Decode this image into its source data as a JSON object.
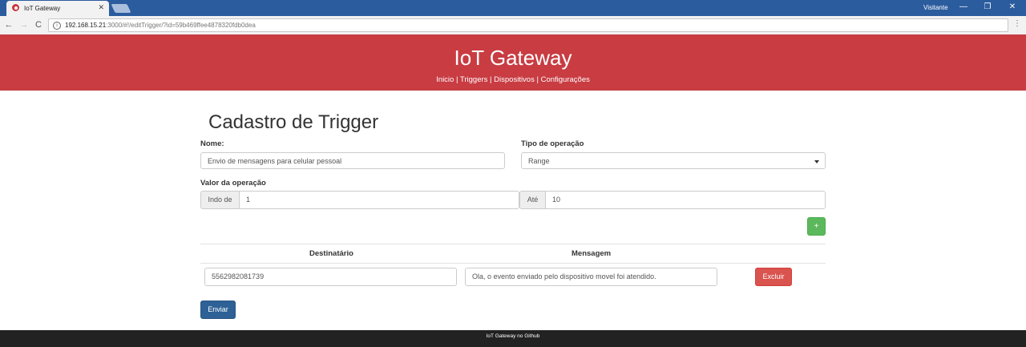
{
  "browser": {
    "tab_title": "IoT Gateway",
    "tab_close": "✕",
    "user_label": "Visitante",
    "minimize": "—",
    "restore": "❐",
    "close": "✕",
    "back": "←",
    "forward": "→",
    "reload": "C",
    "url_host": "192.168.15.21",
    "url_path": ":3000/#!/editTrigger/?id=59b469ffee4878320fdb0dea",
    "menu": "⋮",
    "icons": [
      "favicon-icon",
      "back-arrow-icon",
      "forward-arrow-icon",
      "reload-icon",
      "info-icon",
      "menu-icon"
    ]
  },
  "header": {
    "title": "IoT Gateway",
    "nav": [
      "Inicio",
      "Triggers",
      "Dispositivos",
      "Configurações"
    ],
    "separator": " | ",
    "bg_color": "#c83c42"
  },
  "form": {
    "heading": "Cadastro de Trigger",
    "name_label": "Nome:",
    "name_value": "Envio de mensagens para celular pessoal",
    "operation_type_label": "Tipo de operação",
    "operation_type_value": "Range",
    "operation_value_label": "Valor da operação",
    "from_addon": "Indo de",
    "from_value": "1",
    "to_addon": "Até",
    "to_value": "10",
    "add_button": "+",
    "table": {
      "headers": [
        "Destinatário",
        "Mensagem"
      ],
      "rows": [
        {
          "recipient": "5562982081739",
          "message": "Ola, o evento enviado pelo dispositivo movel foi atendido.",
          "delete_label": "Excluir"
        }
      ]
    },
    "submit_button": "Enviar"
  },
  "footer": {
    "text": "IoT Gateway no Github"
  },
  "colors": {
    "success": "#5cb85c",
    "danger": "#d9534f",
    "primary": "#2e6196"
  }
}
